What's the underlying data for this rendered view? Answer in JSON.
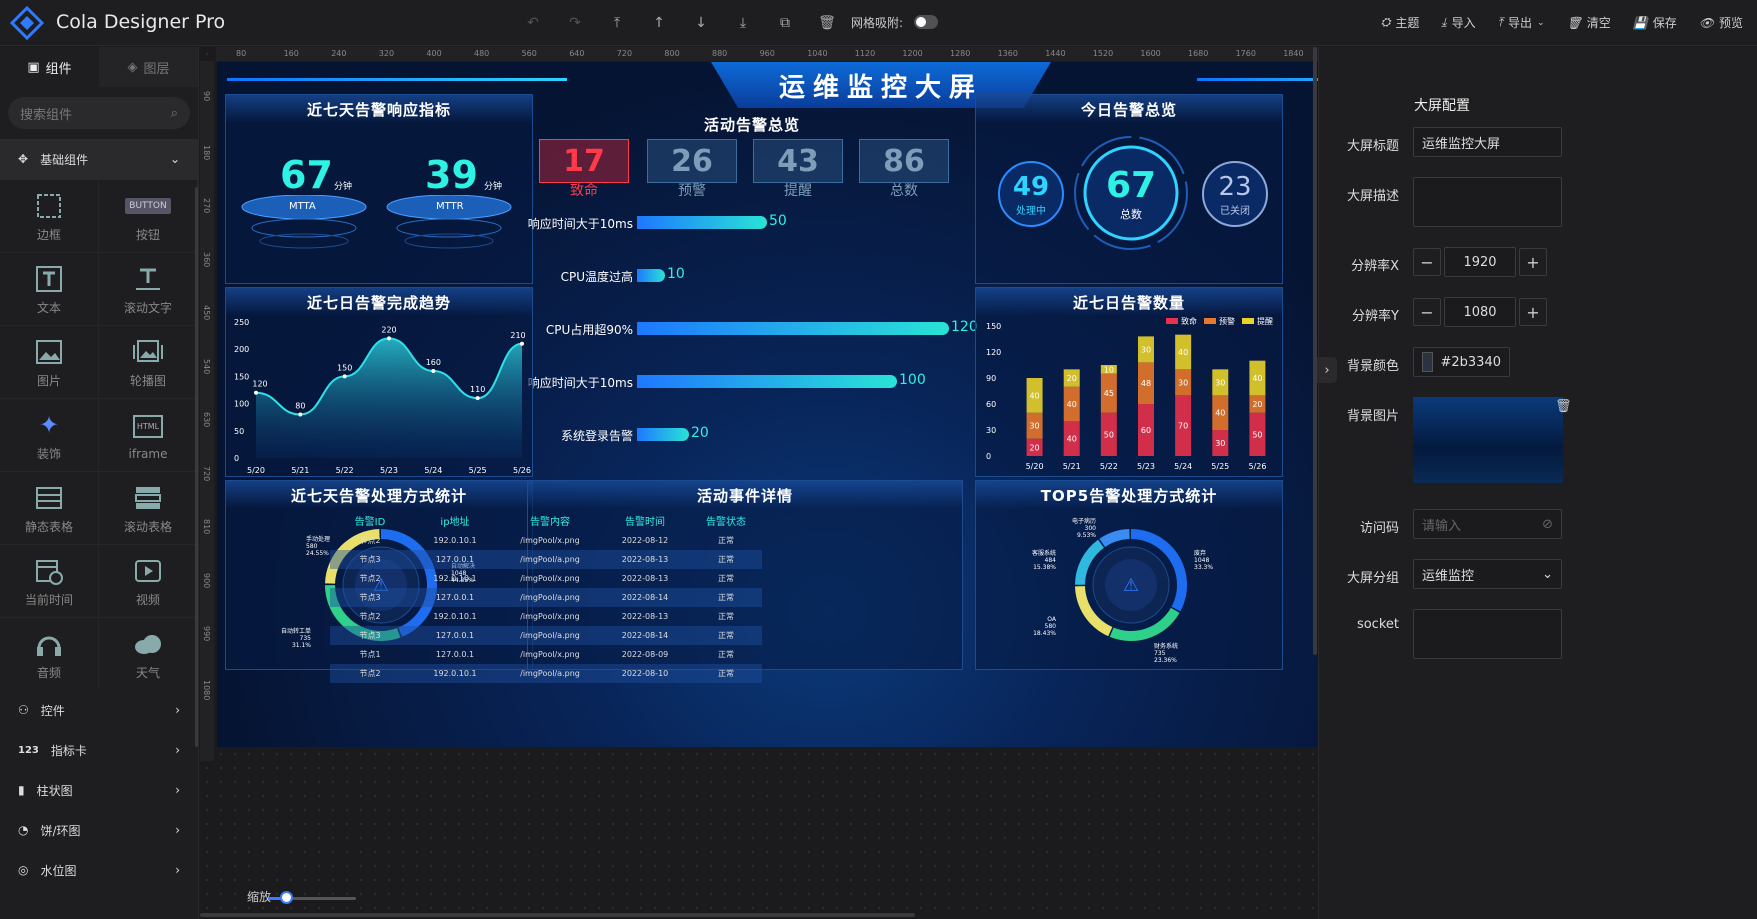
{
  "app": {
    "title": "Cola Designer Pro"
  },
  "toolbar": {
    "grid_snap_label": "网格吸附:",
    "actions": [
      {
        "name": "theme",
        "label": "主题"
      },
      {
        "name": "import",
        "label": "导入"
      },
      {
        "name": "export",
        "label": "导出"
      },
      {
        "name": "clear",
        "label": "清空"
      },
      {
        "name": "save",
        "label": "保存"
      },
      {
        "name": "preview",
        "label": "预览"
      }
    ]
  },
  "left": {
    "tabs": [
      "组件",
      "图层"
    ],
    "search_placeholder": "搜索组件",
    "basic_category": "基础组件",
    "components": [
      "边框",
      "按钮",
      "文本",
      "滚动文字",
      "图片",
      "轮播图",
      "装饰",
      "iframe",
      "静态表格",
      "滚动表格",
      "当前时间",
      "视频",
      "音频",
      "天气"
    ],
    "button_icon_text": "BUTTON",
    "html_icon_text": "HTML",
    "categories": [
      "控件",
      "指标卡",
      "柱状图",
      "饼/环图",
      "水位图"
    ]
  },
  "ruler": {
    "h": [
      "80",
      "160",
      "240",
      "320",
      "400",
      "480",
      "560",
      "640",
      "720",
      "800",
      "880",
      "960",
      "1040",
      "1120",
      "1200",
      "1280",
      "1360",
      "1440",
      "1520",
      "1600",
      "1680",
      "1760",
      "1840",
      "1920"
    ],
    "v": [
      "90",
      "180",
      "270",
      "360",
      "450",
      "540",
      "630",
      "720",
      "810",
      "900",
      "990",
      "1080"
    ]
  },
  "screen": {
    "title": "运维监控大屏",
    "response": {
      "title": "近七天告警响应指标",
      "mtta": "67",
      "mttr": "39",
      "unit": "分钟",
      "mtta_label": "MTTA",
      "mttr_label": "MTTR"
    },
    "active_alerts": {
      "title": "活动告警总览",
      "kpis": [
        {
          "value": "17",
          "label": "致命"
        },
        {
          "value": "26",
          "label": "预警"
        },
        {
          "value": "43",
          "label": "提醒"
        },
        {
          "value": "86",
          "label": "总数"
        }
      ],
      "bars": [
        {
          "label": "响应时间大于10ms",
          "value": 50
        },
        {
          "label": "CPU温度过高",
          "value": 10
        },
        {
          "label": "CPU占用超90%",
          "value": 120
        },
        {
          "label": "响应时间大于10ms",
          "value": 100
        },
        {
          "label": "系统登录告警",
          "value": 20
        }
      ]
    },
    "today": {
      "title": "今日告警总览",
      "processing": "49",
      "processing_label": "处理中",
      "total": "67",
      "total_label": "总数",
      "closed": "23",
      "closed_label": "已关闭"
    },
    "trend": {
      "title": "近七日告警完成趋势"
    },
    "count": {
      "title": "近七日告警数量"
    },
    "handling": {
      "title": "近七天告警处理方式统计"
    },
    "events": {
      "title": "活动事件详情",
      "headers": [
        "告警ID",
        "ip地址",
        "告警内容",
        "告警时间",
        "告警状态"
      ],
      "rows": [
        [
          "节点2",
          "192.0.10.1",
          "/imgPool/x.png",
          "2022-08-12",
          "正常"
        ],
        [
          "节点3",
          "127.0.0.1",
          "/imgPool/a.png",
          "2022-08-13",
          "正常"
        ],
        [
          "节点2",
          "192.0.10.1",
          "/imgPool/x.png",
          "2022-08-13",
          "正常"
        ],
        [
          "节点3",
          "127.0.0.1",
          "/imgPool/a.png",
          "2022-08-14",
          "正常"
        ],
        [
          "节点2",
          "192.0.10.1",
          "/imgPool/x.png",
          "2022-08-13",
          "正常"
        ],
        [
          "节点3",
          "127.0.0.1",
          "/imgPool/a.png",
          "2022-08-14",
          "正常"
        ],
        [
          "节点1",
          "127.0.0.1",
          "/imgPool/x.png",
          "2022-08-09",
          "正常"
        ],
        [
          "节点2",
          "192.0.10.1",
          "/imgPool/a.png",
          "2022-08-10",
          "正常"
        ]
      ]
    },
    "top5": {
      "title": "TOP5告警处理方式统计"
    }
  },
  "chart_data": [
    {
      "type": "area",
      "title": "近七日告警完成趋势",
      "categories": [
        "5/20",
        "5/21",
        "5/22",
        "5/23",
        "5/24",
        "5/25",
        "5/26"
      ],
      "values": [
        120,
        80,
        150,
        220,
        160,
        110,
        210
      ],
      "yticks": [
        "0",
        "50",
        "100",
        "150",
        "200",
        "250"
      ],
      "ylim": [
        0,
        250
      ]
    },
    {
      "type": "bar",
      "title": "近七日告警数量",
      "categories": [
        "5/20",
        "5/21",
        "5/22",
        "5/23",
        "5/24",
        "5/25",
        "5/26"
      ],
      "series": [
        {
          "name": "致命",
          "values": [
            20,
            40,
            50,
            60,
            70,
            30,
            50
          ]
        },
        {
          "name": "预警",
          "values": [
            30,
            40,
            45,
            48,
            30,
            40,
            20
          ]
        },
        {
          "name": "提醒",
          "values": [
            40,
            20,
            10,
            30,
            40,
            30,
            40
          ]
        }
      ],
      "yticks": [
        "0",
        "30",
        "60",
        "90",
        "120",
        "150"
      ],
      "ylim": [
        0,
        150
      ],
      "colors": [
        "#e8314a",
        "#e8782a",
        "#e8d22a"
      ]
    },
    {
      "type": "pie",
      "title": "近七天告警处理方式统计",
      "slices": [
        {
          "name": "自动解决",
          "value": 1048,
          "pct": "44.35%"
        },
        {
          "name": "自动转工单",
          "value": 735,
          "pct": "31.1%"
        },
        {
          "name": "手动处理",
          "value": 580,
          "pct": "24.55%"
        }
      ],
      "colors": [
        "#1e6cf0",
        "#2fd089",
        "#e8e06a"
      ]
    },
    {
      "type": "pie",
      "title": "TOP5告警处理方式统计",
      "slices": [
        {
          "name": "废弃",
          "value": 1048,
          "pct": "33.3%"
        },
        {
          "name": "财务系统",
          "value": 735,
          "pct": "23.36%"
        },
        {
          "name": "OA",
          "value": 580,
          "pct": "18.43%"
        },
        {
          "name": "客服系统",
          "value": 484,
          "pct": "15.38%"
        },
        {
          "name": "电子病历",
          "value": 300,
          "pct": "9.53%"
        }
      ],
      "colors": [
        "#1e6cf0",
        "#2fd089",
        "#e8e06a",
        "#2fb8e0",
        "#3a8cf0"
      ]
    }
  ],
  "right": {
    "title": "大屏配置",
    "fields": {
      "title_label": "大屏标题",
      "title_value": "运维监控大屏",
      "desc_label": "大屏描述",
      "resx_label": "分辨率X",
      "resx_value": "1920",
      "resy_label": "分辨率Y",
      "resy_value": "1080",
      "bg_color_label": "背景颜色",
      "bg_color_value": "#2b3340",
      "bg_image_label": "背景图片",
      "code_label": "访问码",
      "code_placeholder": "请输入",
      "group_label": "大屏分组",
      "group_value": "运维监控",
      "socket_label": "socket"
    }
  },
  "zoom": {
    "label": "缩放",
    "level": 0.2
  }
}
